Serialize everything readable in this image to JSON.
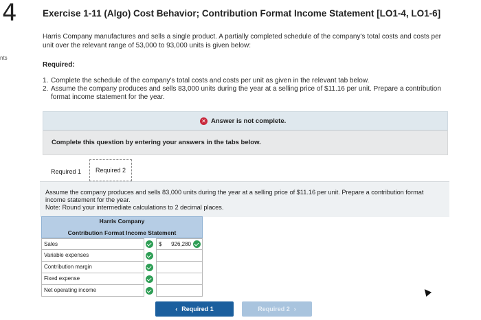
{
  "question_number": "4",
  "points_label": "nts",
  "title": "Exercise 1-11 (Algo) Cost Behavior; Contribution Format Income Statement [LO1-4, LO1-6]",
  "intro": "Harris Company manufactures and sells a single product. A partially completed schedule of the company's total costs and costs per unit over the relevant range of 53,000 to 93,000 units is given below:",
  "required_heading": "Required:",
  "requirements": [
    {
      "num": "1.",
      "text": "Complete the schedule of the company's total costs and costs per unit as given in the relevant tab below."
    },
    {
      "num": "2.",
      "text": "Assume the company produces and sells 83,000 units during the year at a selling price of $11.16 per unit. Prepare a contribution format income statement for the year."
    }
  ],
  "status_banner": {
    "icon": "x-circle-icon",
    "text": "Answer is not complete."
  },
  "instruction": "Complete this question by entering your answers in the tabs below.",
  "tabs": [
    {
      "label": "Required 1",
      "active": false
    },
    {
      "label": "Required 2",
      "active": true
    }
  ],
  "panel": {
    "line1": "Assume the company produces and sells 83,000 units during the year at a selling price of $11.16 per unit. Prepare a contribution format income statement for the year.",
    "note": "Note: Round your intermediate calculations to 2 decimal places."
  },
  "statement": {
    "company": "Harris Company",
    "title": "Contribution Format Income Statement",
    "rows": [
      {
        "label": "Sales",
        "currency": "$",
        "value": "926,280"
      },
      {
        "label": "Variable expenses",
        "currency": "",
        "value": ""
      },
      {
        "label": "Contribution margin",
        "currency": "",
        "value": ""
      },
      {
        "label": "Fixed expense",
        "currency": "",
        "value": ""
      },
      {
        "label": "Net operating income",
        "currency": "",
        "value": ""
      }
    ]
  },
  "nav": {
    "prev_label": "Required 1",
    "prev_arrow": "‹",
    "next_label": "Required 2",
    "next_arrow": "›"
  },
  "colors": {
    "primary_button": "#1b5f9e",
    "disabled_button": "#a9c4de",
    "table_header": "#b6cde5",
    "check_green": "#2e9e55",
    "error_red": "#c8283c"
  }
}
